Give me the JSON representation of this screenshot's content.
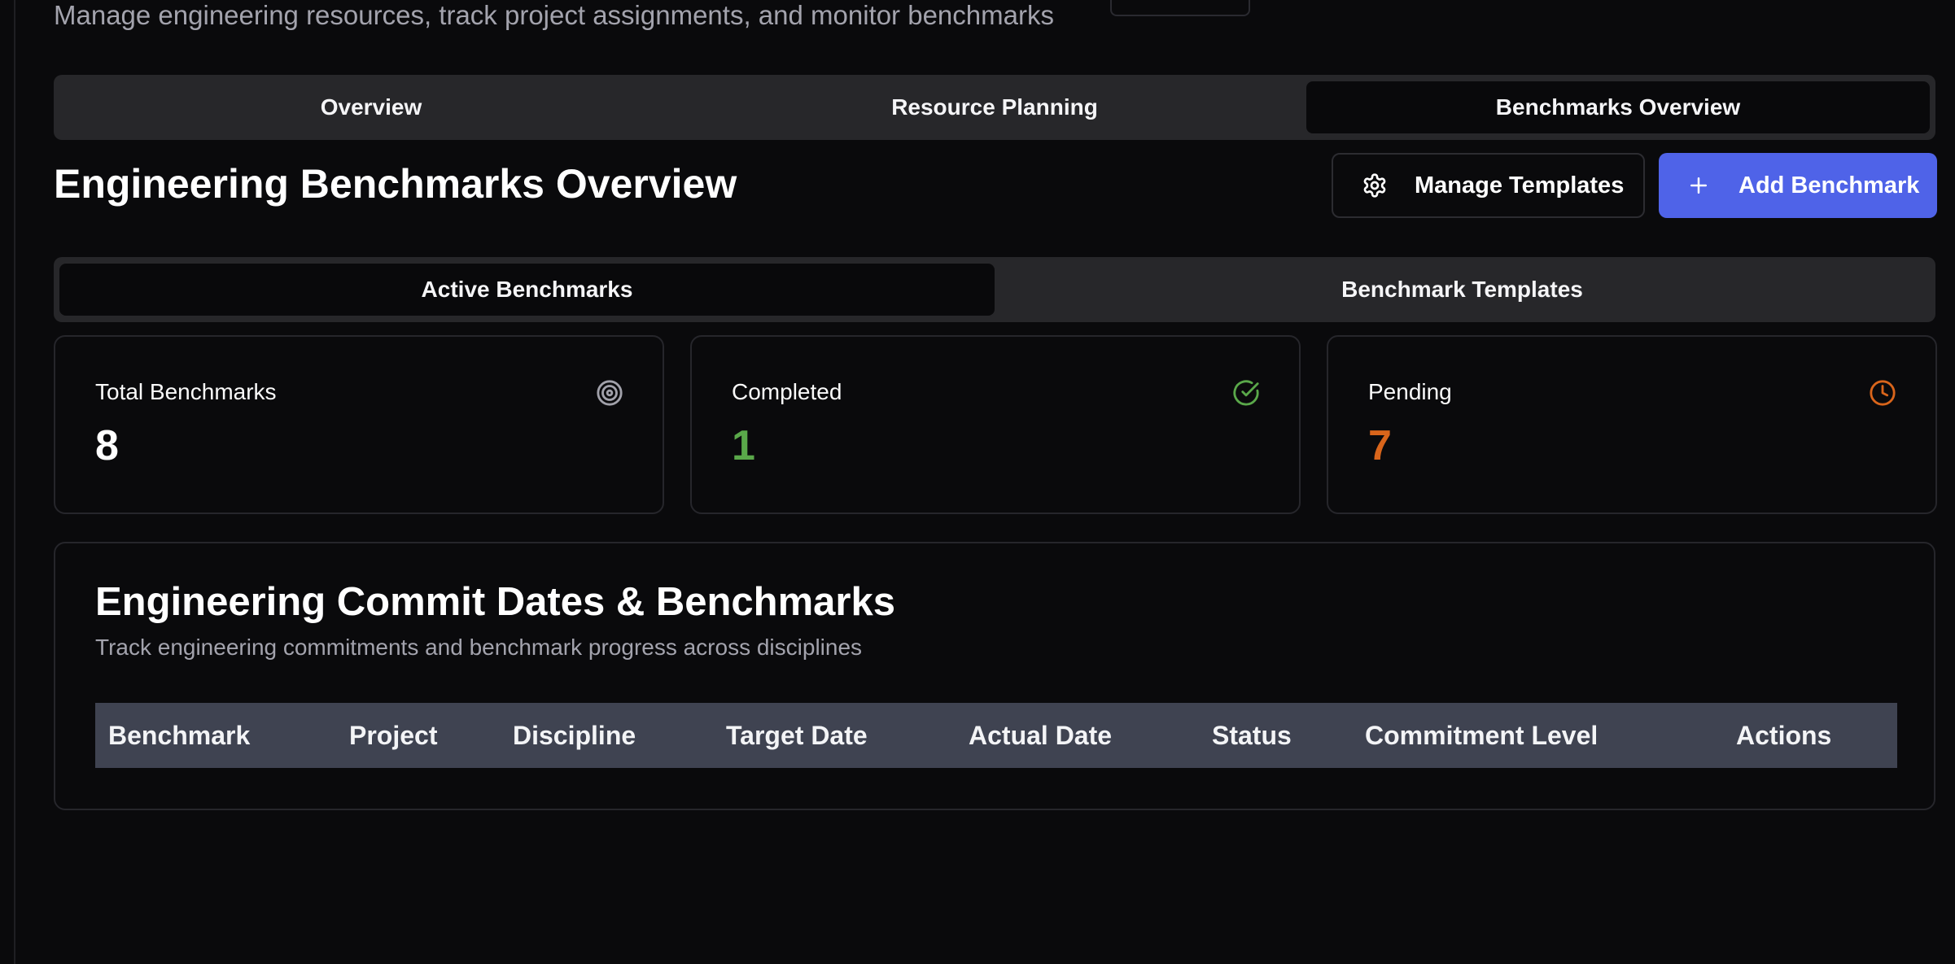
{
  "header": {
    "subtitle": "Manage engineering resources, track project assignments, and monitor benchmarks"
  },
  "main_tabs": [
    {
      "label": "Overview",
      "active": false
    },
    {
      "label": "Resource Planning",
      "active": false
    },
    {
      "label": "Benchmarks Overview",
      "active": true
    }
  ],
  "page": {
    "title": "Engineering Benchmarks Overview",
    "manage_templates_label": "Manage Templates",
    "add_benchmark_label": "Add Benchmark"
  },
  "sub_tabs": [
    {
      "label": "Active Benchmarks",
      "active": true
    },
    {
      "label": "Benchmark Templates",
      "active": false
    }
  ],
  "stats": {
    "total": {
      "label": "Total Benchmarks",
      "value": "8",
      "icon": "target-icon",
      "color": "#ffffff"
    },
    "completed": {
      "label": "Completed",
      "value": "1",
      "icon": "check-circle-icon",
      "color": "#5aa84a"
    },
    "pending": {
      "label": "Pending",
      "value": "7",
      "icon": "clock-icon",
      "color": "#d9651b"
    }
  },
  "table_panel": {
    "title": "Engineering Commit Dates & Benchmarks",
    "subtitle": "Track engineering commitments and benchmark progress across disciplines",
    "columns": [
      "Benchmark",
      "Project",
      "Discipline",
      "Target Date",
      "Actual Date",
      "Status",
      "Commitment Level",
      "Actions"
    ]
  },
  "colors": {
    "accent": "#4f63e8",
    "background": "#0a0a0c",
    "tab_bar": "#27272a",
    "table_header": "#3f4351"
  }
}
